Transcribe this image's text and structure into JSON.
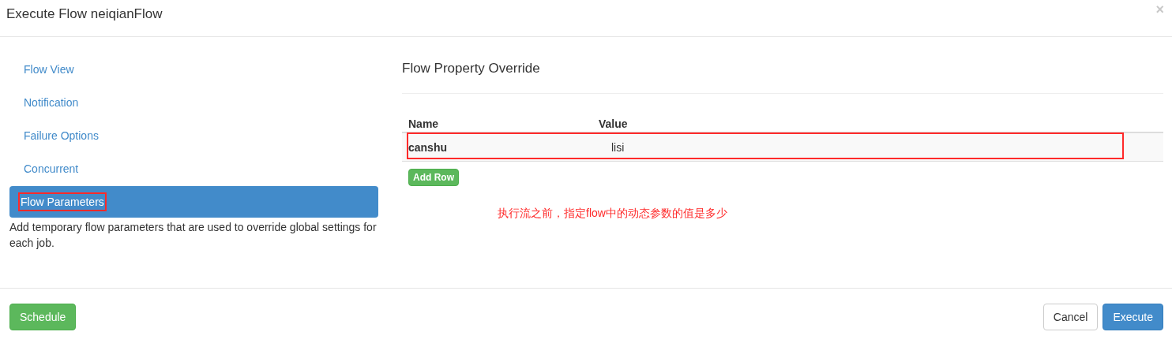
{
  "dialog": {
    "title": "Execute Flow neiqianFlow",
    "close": "×"
  },
  "sidebar": {
    "items": [
      {
        "label": "Flow View",
        "selected": false,
        "highlighted": false
      },
      {
        "label": "Notification",
        "selected": false,
        "highlighted": false
      },
      {
        "label": "Failure Options",
        "selected": false,
        "highlighted": false
      },
      {
        "label": "Concurrent",
        "selected": false,
        "highlighted": false
      },
      {
        "label": "Flow Parameters",
        "selected": true,
        "highlighted": true
      }
    ],
    "description": "Add temporary flow parameters that are used to override global settings for each job."
  },
  "panel": {
    "heading": "Flow Property Override",
    "table": {
      "columns": [
        "Name",
        "Value"
      ],
      "rows": [
        {
          "name": "canshu",
          "value": "lisi",
          "highlighted": true
        }
      ]
    },
    "add_button": "Add Row",
    "annotation": "执行流之前，指定flow中的动态参数的值是多少"
  },
  "footer": {
    "buttons": [
      {
        "label": "Schedule",
        "kind": "success"
      },
      {
        "label": "Cancel",
        "kind": "default"
      },
      {
        "label": "Execute",
        "kind": "primary"
      }
    ]
  }
}
